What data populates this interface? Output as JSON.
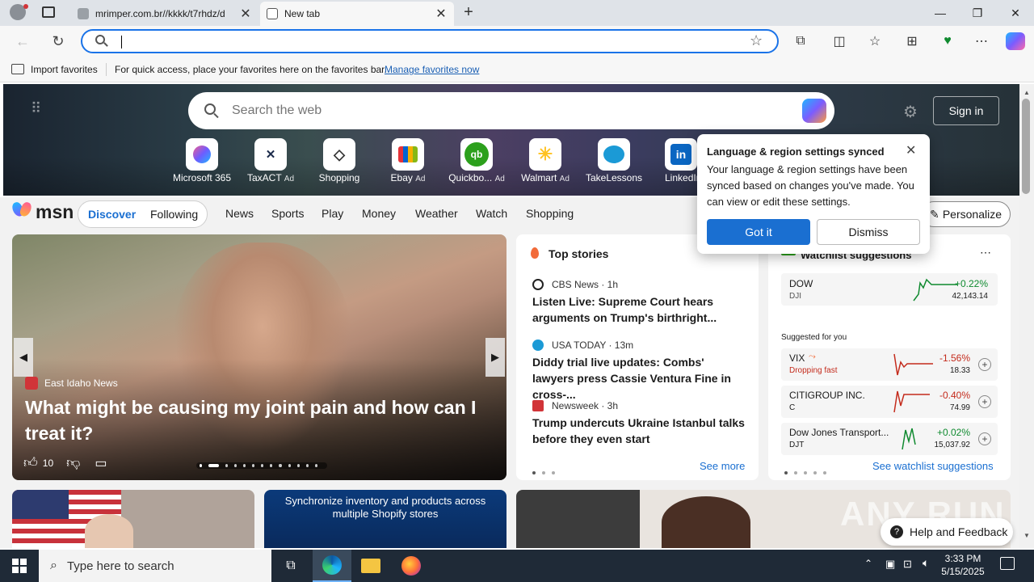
{
  "browser": {
    "tabs": [
      {
        "title": "mrimper.com.br//kkkk/t7rhdz/d",
        "active": false
      },
      {
        "title": "New tab",
        "active": true
      }
    ],
    "address_value": "",
    "favorites_bar": {
      "import_label": "Import favorites",
      "hint": "For quick access, place your favorites here on the favorites bar.",
      "manage_link": "Manage favorites now"
    }
  },
  "hero": {
    "search_placeholder": "Search the web",
    "signin": "Sign in",
    "quicklinks": [
      {
        "label": "Microsoft 365",
        "ad": ""
      },
      {
        "label": "TaxACT",
        "ad": "Ad"
      },
      {
        "label": "Shopping",
        "ad": ""
      },
      {
        "label": "Ebay",
        "ad": "Ad"
      },
      {
        "label": "Quickbo...",
        "ad": "Ad"
      },
      {
        "label": "Walmart",
        "ad": "Ad"
      },
      {
        "label": "TakeLessons",
        "ad": ""
      },
      {
        "label": "LinkedIn",
        "ad": ""
      }
    ]
  },
  "nav": {
    "brand": "msn",
    "toggle": [
      "Discover",
      "Following"
    ],
    "links": [
      "News",
      "Sports",
      "Play",
      "Money",
      "Weather",
      "Watch",
      "Shopping"
    ],
    "personalize": "Personalize"
  },
  "popup": {
    "title": "Language & region settings synced",
    "body": "Your language & region settings have been synced based on changes you've made. You can view or edit these settings.",
    "got_it": "Got it",
    "dismiss": "Dismiss"
  },
  "feature": {
    "source": "East Idaho News",
    "headline": "What might be causing my joint pain and how can I treat it?",
    "likes": "10"
  },
  "top_stories": {
    "heading": "Top stories",
    "items": [
      {
        "source": "CBS News · 1h",
        "title": "Listen Live: Supreme Court hears arguments on Trump's birthright..."
      },
      {
        "source": "USA TODAY · 13m",
        "title": "Diddy trial live updates: Combs' lawyers press Cassie Ventura Fine in cross-..."
      },
      {
        "source": "Newsweek · 3h",
        "title": "Trump undercuts Ukraine Istanbul talks before they even start"
      }
    ],
    "see_more": "See more"
  },
  "watchlist": {
    "heading": "Watchlist suggestions",
    "main": {
      "name": "DOW",
      "ticker": "DJI",
      "change": "+0.22%",
      "price": "42,143.14"
    },
    "suggested_label": "Suggested for you",
    "suggested": [
      {
        "name": "VIX",
        "sub": "Dropping fast",
        "change": "-1.56%",
        "price": "18.33"
      },
      {
        "name": "CITIGROUP INC.",
        "sub": "C",
        "change": "-0.40%",
        "price": "74.99"
      },
      {
        "name": "Dow Jones Transport...",
        "sub": "DJT",
        "change": "+0.02%",
        "price": "15,037.92"
      }
    ],
    "see_link": "See watchlist suggestions"
  },
  "bottom": {
    "ad_text": "Synchronize inventory and products across multiple Shopify stores",
    "help": "Help and Feedback",
    "watermark": "ANY RUN"
  },
  "taskbar": {
    "search_placeholder": "Type here to search",
    "time": "3:33 PM",
    "date": "5/15/2025"
  }
}
